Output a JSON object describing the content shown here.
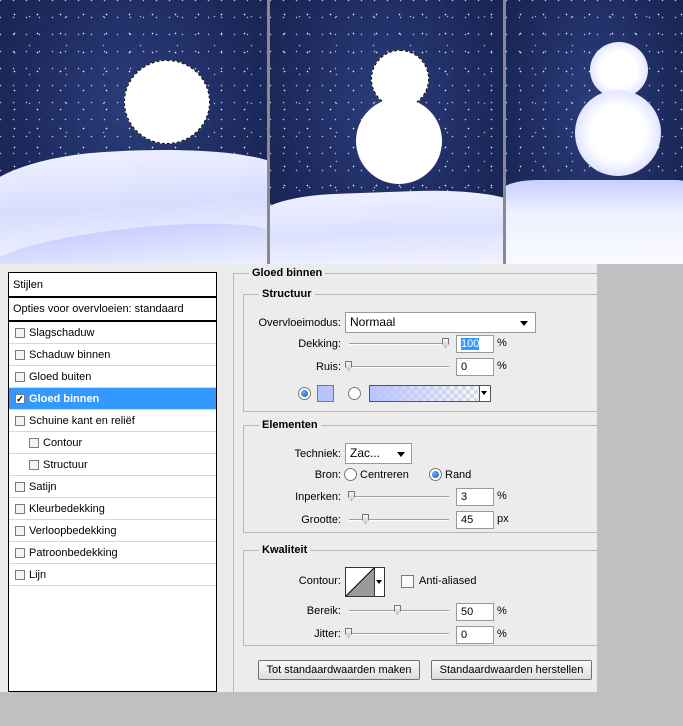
{
  "styles_panel": {
    "header": "Stijlen",
    "blend_options": "Opties voor overvloeien: standaard",
    "items": [
      {
        "label": "Slagschaduw",
        "checked": false,
        "indent": false,
        "active": false
      },
      {
        "label": "Schaduw binnen",
        "checked": false,
        "indent": false,
        "active": false
      },
      {
        "label": "Gloed buiten",
        "checked": false,
        "indent": false,
        "active": false
      },
      {
        "label": "Gloed binnen",
        "checked": true,
        "indent": false,
        "active": true
      },
      {
        "label": "Schuine kant en reliëf",
        "checked": false,
        "indent": false,
        "active": false
      },
      {
        "label": "Contour",
        "checked": false,
        "indent": true,
        "active": false
      },
      {
        "label": "Structuur",
        "checked": false,
        "indent": true,
        "active": false
      },
      {
        "label": "Satijn",
        "checked": false,
        "indent": false,
        "active": false
      },
      {
        "label": "Kleurbedekking",
        "checked": false,
        "indent": false,
        "active": false
      },
      {
        "label": "Verloopbedekking",
        "checked": false,
        "indent": false,
        "active": false
      },
      {
        "label": "Patroonbedekking",
        "checked": false,
        "indent": false,
        "active": false
      },
      {
        "label": "Lijn",
        "checked": false,
        "indent": false,
        "active": false
      }
    ]
  },
  "settings": {
    "title": "Gloed binnen",
    "structure": {
      "title": "Structuur",
      "blend_mode_label": "Overvloeimodus:",
      "blend_mode_value": "Normaal",
      "opacity_label": "Dekking:",
      "opacity_value": "100",
      "opacity_level": 1.0,
      "noise_label": "Ruis:",
      "noise_value": "0",
      "noise_level": 0.0,
      "unit": "%",
      "glow_color": "#b8c4ff"
    },
    "elements": {
      "title": "Elementen",
      "technique_label": "Techniek:",
      "technique_value": "Zac...",
      "source_label": "Bron:",
      "source_center": "Centreren",
      "source_edge": "Rand",
      "choke_label": "Inperken:",
      "choke_value": "3",
      "choke_level": 0.03,
      "size_label": "Grootte:",
      "size_value": "45",
      "size_unit": "px",
      "size_level": 0.18,
      "unit": "%"
    },
    "quality": {
      "title": "Kwaliteit",
      "contour_label": "Contour:",
      "anti_alias_label": "Anti-aliased",
      "range_label": "Bereik:",
      "range_value": "50",
      "range_level": 0.5,
      "jitter_label": "Jitter:",
      "jitter_value": "0",
      "jitter_level": 0.0,
      "unit": "%"
    },
    "buttons": {
      "make_default": "Tot standaardwaarden maken",
      "reset_default": "Standaardwaarden herstellen"
    }
  },
  "colors": {
    "night_sky": "#1c2a5e",
    "snow": "#f2f3ff",
    "selection": "#3399ff"
  }
}
